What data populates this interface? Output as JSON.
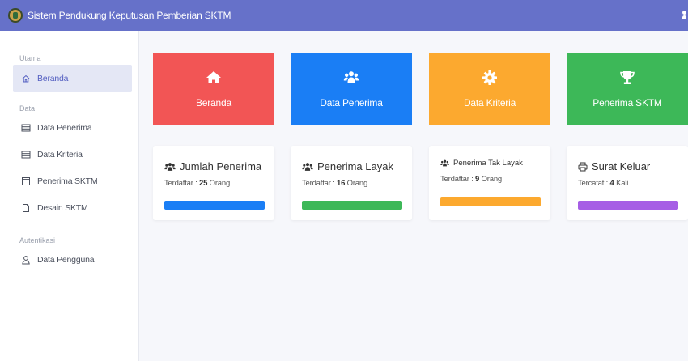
{
  "header": {
    "title": "Sistem Pendukung Keputusan Pemberian SKTM"
  },
  "sidebar": {
    "sections": [
      {
        "label": "Utama"
      },
      {
        "label": "Data"
      },
      {
        "label": "Autentikasi"
      }
    ],
    "items": [
      {
        "label": "Beranda",
        "icon": "home-icon",
        "active": true
      },
      {
        "label": "Data Penerima",
        "icon": "list-icon"
      },
      {
        "label": "Data Kriteria",
        "icon": "list-icon"
      },
      {
        "label": "Penerima SKTM",
        "icon": "calendar-icon"
      },
      {
        "label": "Desain SKTM",
        "icon": "document-icon"
      },
      {
        "label": "Data Pengguna",
        "icon": "user-icon"
      }
    ]
  },
  "tiles": [
    {
      "label": "Beranda",
      "icon": "home-icon",
      "color": "#f25555"
    },
    {
      "label": "Data Penerima",
      "icon": "users-icon",
      "color": "#1a7ef5"
    },
    {
      "label": "Data Kriteria",
      "icon": "gear-icon",
      "color": "#fca92f"
    },
    {
      "label": "Penerima SKTM",
      "icon": "trophy-icon",
      "color": "#3db858"
    }
  ],
  "cards": [
    {
      "title": "Jumlah Penerima",
      "icon": "users-icon",
      "sub_label": "Terdaftar :",
      "value": "25",
      "unit": "Orang",
      "bar_color": "#1a7ef5"
    },
    {
      "title": "Penerima Layak",
      "icon": "users-icon",
      "sub_label": "Terdaftar :",
      "value": "16",
      "unit": "Orang",
      "bar_color": "#3db858"
    },
    {
      "title": "Penerima Tak Layak",
      "icon": "users-icon",
      "sub_label": "Terdaftar :",
      "value": "9",
      "unit": "Orang",
      "bar_color": "#fca92f"
    },
    {
      "title": "Surat Keluar",
      "icon": "printer-icon",
      "sub_label": "Tercatat :",
      "value": "4",
      "unit": "Kali",
      "bar_color": "#a65ee5"
    }
  ]
}
